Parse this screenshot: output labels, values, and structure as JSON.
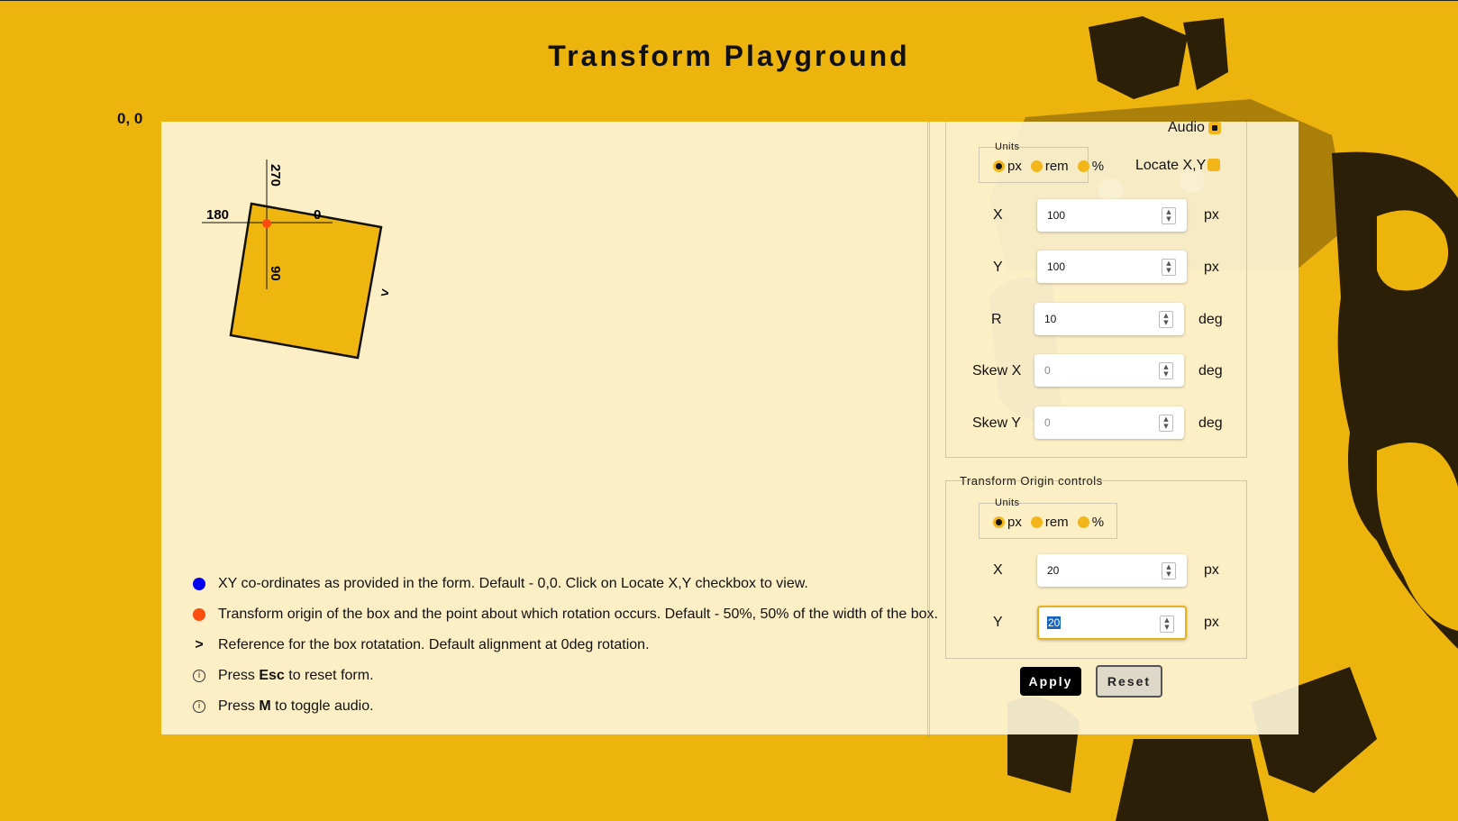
{
  "title": "Transform Playground",
  "origin_coord": "0, 0",
  "stage": {
    "axis_labels": {
      "left": "180",
      "right": "0",
      "top": "270",
      "bottom": "90"
    },
    "rotation_reference": ">"
  },
  "legend": [
    {
      "icon": "blue-dot",
      "text": "XY co-ordinates as provided in the form. Default - 0,0. Click on Locate X,Y checkbox to view."
    },
    {
      "icon": "red-dot",
      "text": "Transform origin of the box and the point about which rotation occurs. Default - 50%, 50% of the width of the box."
    },
    {
      "icon": "chevron",
      "mark": ">",
      "text": "Reference for the box rotatation. Default alignment at 0deg rotation."
    },
    {
      "icon": "info",
      "mark": "i",
      "pre": "Press ",
      "key": "Esc",
      "post": " to reset form."
    },
    {
      "icon": "info",
      "mark": "i",
      "pre": "Press ",
      "key": "M",
      "post": " to toggle audio."
    }
  ],
  "controls": {
    "audio_label": "Audio",
    "audio_checked": true,
    "units_label": "Units",
    "unit_options": [
      "px",
      "rem",
      "%"
    ],
    "unit_selected": "px",
    "locate_label": "Locate X,Y",
    "locate_checked": false,
    "fields": [
      {
        "label": "X",
        "value": "100",
        "unit": "px"
      },
      {
        "label": "Y",
        "value": "100",
        "unit": "px"
      },
      {
        "label": "R",
        "value": "10",
        "unit": "deg"
      },
      {
        "label": "Skew X",
        "value": "0",
        "unit": "deg"
      },
      {
        "label": "Skew Y",
        "value": "0",
        "unit": "deg"
      }
    ],
    "origin_section_label": "Transform Origin controls",
    "origin_units_label": "Units",
    "origin_unit_options": [
      "px",
      "rem",
      "%"
    ],
    "origin_unit_selected": "px",
    "origin_fields": [
      {
        "label": "X",
        "value": "20",
        "unit": "px"
      },
      {
        "label": "Y",
        "value": "20",
        "unit": "px"
      }
    ],
    "apply_label": "Apply",
    "reset_label": "Reset"
  },
  "colors": {
    "background": "#EDB40D",
    "panel": "#FDF3D5",
    "box_fill": "#EFB60F",
    "transform_origin": "#FF4D0F",
    "xy_marker": "#0000EE"
  }
}
